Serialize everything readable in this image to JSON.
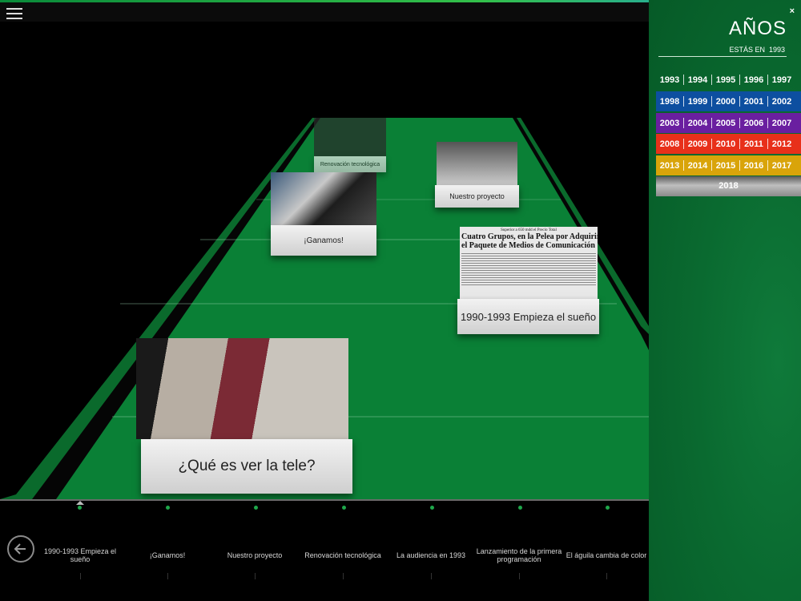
{
  "panel": {
    "title": "AÑOS",
    "current_label": "ESTÁS EN",
    "current_year": "1993",
    "close": "×",
    "rows": [
      {
        "color": "",
        "years": [
          "1993",
          "1994",
          "1995",
          "1996",
          "1997"
        ]
      },
      {
        "color": "#0d4fa0",
        "years": [
          "1998",
          "1999",
          "2000",
          "2001",
          "2002"
        ]
      },
      {
        "color": "#6a1fa0",
        "years": [
          "2003",
          "2004",
          "2005",
          "2006",
          "2007"
        ]
      },
      {
        "color": "#e8301a",
        "years": [
          "2008",
          "2009",
          "2010",
          "2011",
          "2012"
        ]
      },
      {
        "color": "#d9a40a",
        "years": [
          "2013",
          "2014",
          "2015",
          "2016",
          "2017"
        ]
      }
    ],
    "last_year": "2018"
  },
  "cards": {
    "card1": "¿Qué es ver la tele?",
    "card2": "1990-1993 Empieza el sueño",
    "card3": "¡Ganamos!",
    "card4": "Nuestro proyecto",
    "card5": "Renovación tecnológica"
  },
  "newspaper": {
    "kicker": "Superior a 650 mdd el Precio Total",
    "headline1": "Cuatro Grupos, en la Pelea por Adquirir",
    "headline2": "el Paquete de Medios de Comunicación"
  },
  "timeline": {
    "items": [
      "1990-1993 Empieza el sueño",
      "¡Ganamos!",
      "Nuestro proyecto",
      "Renovación tecnológica",
      "La audiencia en 1993",
      "Lanzamiento de la primera programación",
      "El águila cambia de color"
    ]
  },
  "colors": {
    "track": "#0a8036",
    "accent_green": "#1ea64a",
    "panel_green": "#0a6a30"
  },
  "icons": {
    "menu": "hamburger-icon",
    "back": "arrow-left-circle-icon",
    "close": "close-icon"
  }
}
